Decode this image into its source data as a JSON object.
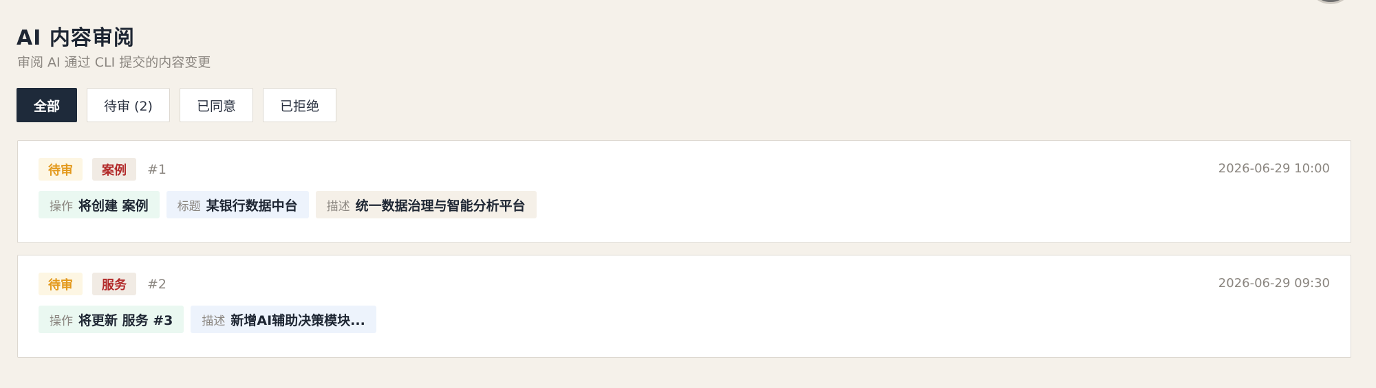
{
  "header": {
    "title": "AI 内容审阅",
    "subtitle": "审阅 AI 通过 CLI 提交的内容变更"
  },
  "tabs": [
    {
      "label": "全部",
      "active": true
    },
    {
      "label": "待审 (2)",
      "active": false
    },
    {
      "label": "已同意",
      "active": false
    },
    {
      "label": "已拒绝",
      "active": false
    }
  ],
  "items": [
    {
      "status": "待审",
      "type": "案例",
      "id": "#1",
      "time": "2026-06-29 10:00",
      "fields": [
        {
          "key": "操作",
          "value": "将创建 案例"
        },
        {
          "key": "标题",
          "value": "某银行数据中台"
        },
        {
          "key": "描述",
          "value": "统一数据治理与智能分析平台"
        }
      ]
    },
    {
      "status": "待审",
      "type": "服务",
      "id": "#2",
      "time": "2026-06-29 09:30",
      "fields": [
        {
          "key": "操作",
          "value": "将更新 服务 #3"
        },
        {
          "key": "描述",
          "value": "新增AI辅助决策模块..."
        }
      ]
    }
  ],
  "colors": {
    "background": "#f5f1ea",
    "primary": "#1e2a3a",
    "pending": "#e3991c",
    "type_accent": "#b22a2a"
  }
}
